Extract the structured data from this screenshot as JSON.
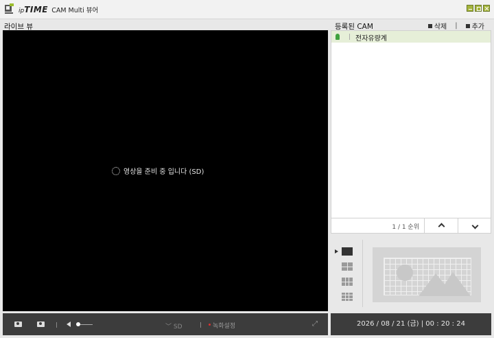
{
  "app": {
    "brand_ip": "ip",
    "brand_time": "TIME",
    "brand_rest": "CAM Multi 뷰어",
    "accent": "#a5b43c"
  },
  "live": {
    "title": "라이브 뷰",
    "status_text": "영상을 준비 중 입니다 (SD)"
  },
  "controls": {
    "quality": "SD",
    "record_settings": "녹화설정"
  },
  "cams": {
    "title": "등록된 CAM",
    "delete_label": "삭제",
    "add_label": "추가",
    "items": [
      {
        "name": "전자유량계",
        "status": "online"
      }
    ],
    "page_label": "1 / 1 순위"
  },
  "footer": {
    "datetime": "2026 / 08 / 21 (금)   |   00 : 20 : 24"
  }
}
